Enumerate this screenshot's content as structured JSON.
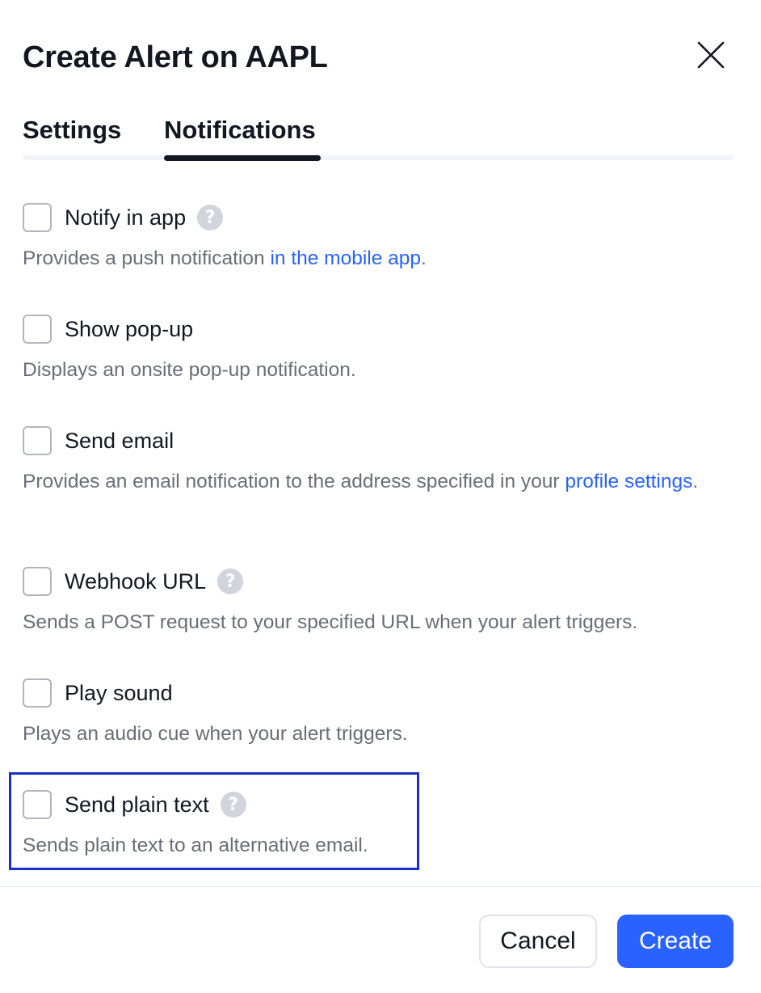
{
  "dialog": {
    "title": "Create Alert on AAPL"
  },
  "tabs": [
    {
      "label": "Settings",
      "active": false
    },
    {
      "label": "Notifications",
      "active": true
    }
  ],
  "options": {
    "notify_in_app": {
      "label": "Notify in app",
      "checked": false,
      "desc_prefix": "Provides a push notification ",
      "desc_link": "in the mobile app",
      "desc_suffix": "."
    },
    "show_popup": {
      "label": "Show pop-up",
      "checked": false,
      "desc": "Displays an onsite pop-up notification."
    },
    "send_email": {
      "label": "Send email",
      "checked": false,
      "desc_prefix": "Provides an email notification to the address specified in your ",
      "desc_link": "profile settings",
      "desc_suffix": "."
    },
    "webhook_url": {
      "label": "Webhook URL",
      "checked": false,
      "desc": "Sends a POST request to your specified URL when your alert triggers."
    },
    "play_sound": {
      "label": "Play sound",
      "checked": false,
      "desc": "Plays an audio cue when your alert triggers."
    },
    "send_plain_text": {
      "label": "Send plain text",
      "checked": false,
      "desc": "Sends plain text to an alternative email."
    }
  },
  "help_glyph": "?",
  "footer": {
    "cancel_label": "Cancel",
    "create_label": "Create"
  },
  "colors": {
    "accent": "#2962ff",
    "text": "#131722",
    "muted": "#6a6d78",
    "highlight_border": "#1a2fc9"
  },
  "icons": {
    "close": "close-icon",
    "help": "question-circle-icon"
  }
}
